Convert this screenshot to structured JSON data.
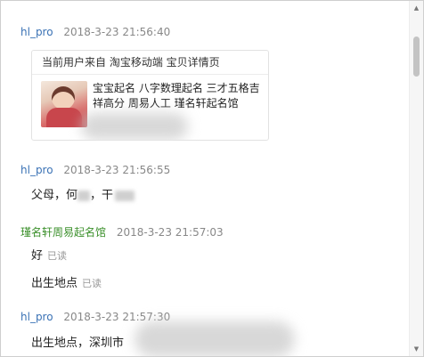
{
  "messages": [
    {
      "sender": "hl_pro",
      "time": "2018-3-23  21:56:40",
      "card": {
        "header": "当前用户来自 淘宝移动端 宝贝详情页",
        "description": "宝宝起名 八字数理起名 三才五格吉祥高分 周易人工 瑾名轩起名馆"
      }
    },
    {
      "sender": "hl_pro",
      "time": "2018-3-23  21:56:55",
      "text_a": "父母，何",
      "text_b": "，干"
    },
    {
      "sender": "瑾名轩周易起名馆",
      "time": "2018-3-23  21:57:03",
      "replies": [
        {
          "text": "好",
          "status": "已读"
        },
        {
          "text": "出生地点",
          "status": "已读"
        }
      ]
    },
    {
      "sender": "hl_pro",
      "time": "2018-3-23  21:57:30",
      "text": "出生地点，深圳市"
    }
  ],
  "scrollbar": {
    "up_icon": "triangle-up",
    "down_icon": "triangle-down"
  }
}
